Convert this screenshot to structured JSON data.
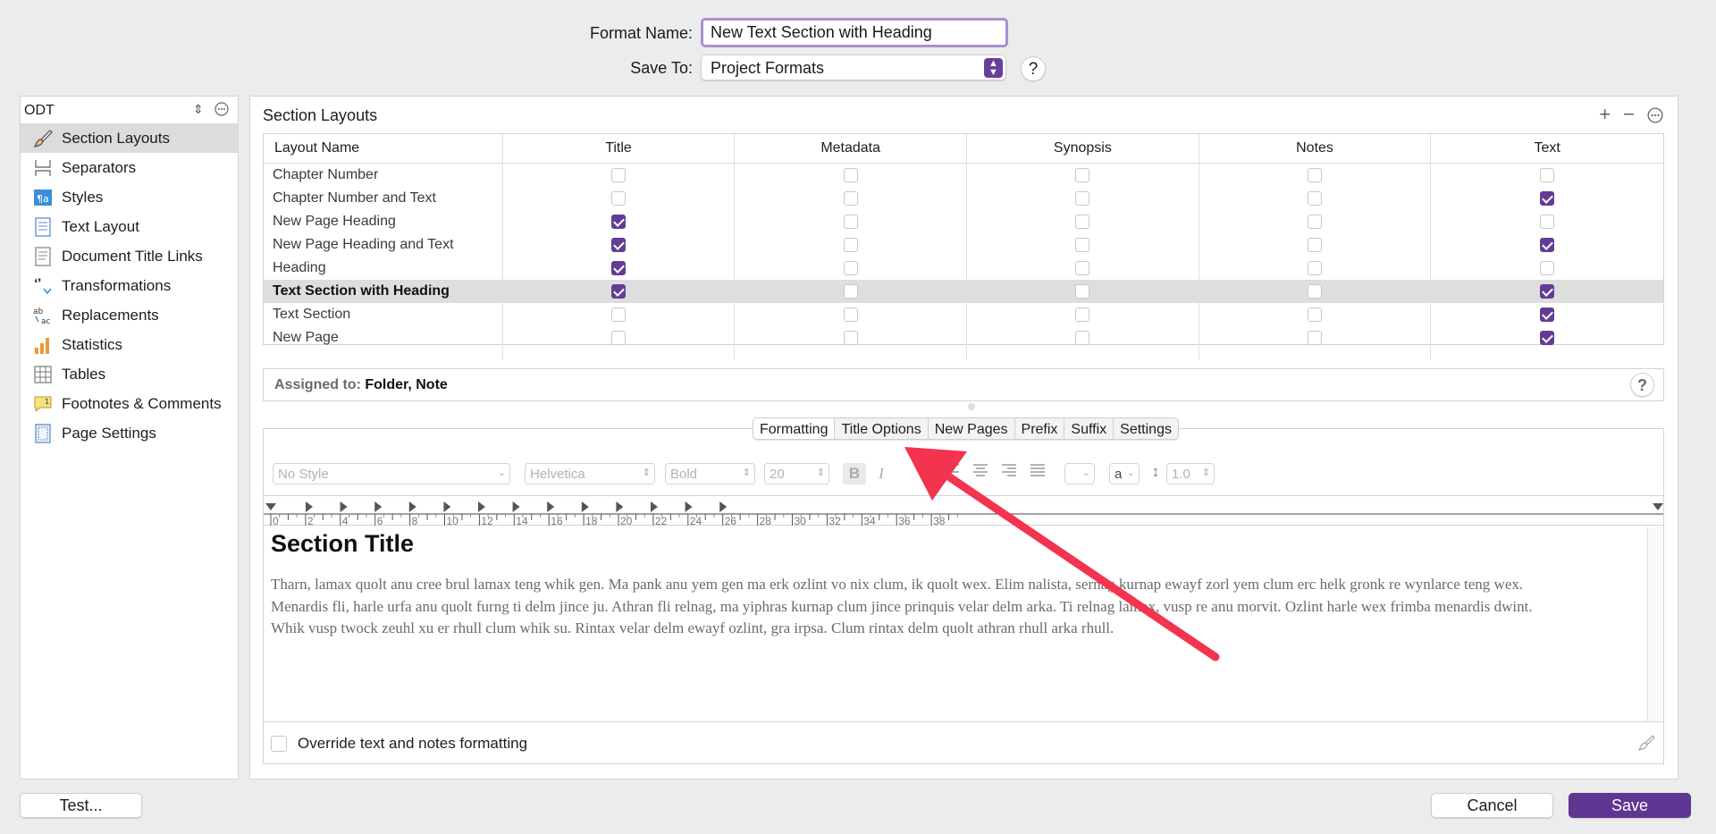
{
  "form": {
    "format_name_label": "Format Name:",
    "format_name_value": "New Text Section with Heading",
    "save_to_label": "Save To:",
    "save_to_value": "Project Formats"
  },
  "sidebar": {
    "header": "ODT",
    "items": [
      {
        "label": "Section Layouts",
        "icon": "paintbrush-icon",
        "active": true
      },
      {
        "label": "Separators",
        "icon": "separator-icon"
      },
      {
        "label": "Styles",
        "icon": "styles-icon"
      },
      {
        "label": "Text Layout",
        "icon": "text-layout-icon"
      },
      {
        "label": "Document Title Links",
        "icon": "document-icon"
      },
      {
        "label": "Transformations",
        "icon": "quotes-icon"
      },
      {
        "label": "Replacements",
        "icon": "replace-icon"
      },
      {
        "label": "Statistics",
        "icon": "bar-chart-icon"
      },
      {
        "label": "Tables",
        "icon": "table-icon"
      },
      {
        "label": "Footnotes & Comments",
        "icon": "footnote-icon"
      },
      {
        "label": "Page Settings",
        "icon": "page-settings-icon"
      }
    ]
  },
  "main": {
    "title": "Section Layouts",
    "table": {
      "headers": [
        "Layout Name",
        "Title",
        "Metadata",
        "Synopsis",
        "Notes",
        "Text"
      ],
      "rows": [
        {
          "name": "Chapter Number",
          "checks": [
            false,
            false,
            false,
            false,
            false
          ]
        },
        {
          "name": "Chapter Number and Text",
          "checks": [
            false,
            false,
            false,
            false,
            true
          ]
        },
        {
          "name": "New Page Heading",
          "checks": [
            true,
            false,
            false,
            false,
            false
          ]
        },
        {
          "name": "New Page Heading and Text",
          "checks": [
            true,
            false,
            false,
            false,
            true
          ]
        },
        {
          "name": "Heading",
          "checks": [
            true,
            false,
            false,
            false,
            false
          ]
        },
        {
          "name": "Text Section with Heading",
          "checks": [
            true,
            false,
            false,
            false,
            true
          ],
          "selected": true
        },
        {
          "name": "Text Section",
          "checks": [
            false,
            false,
            false,
            false,
            true
          ]
        },
        {
          "name": "New Page",
          "checks": [
            false,
            false,
            false,
            false,
            true
          ]
        }
      ]
    },
    "assigned_label": "Assigned to:",
    "assigned_value": "Folder, Note",
    "tabs": [
      "Formatting",
      "Title Options",
      "New Pages",
      "Prefix",
      "Suffix",
      "Settings"
    ],
    "active_tab": "Formatting",
    "toolbar": {
      "style": "No Style",
      "font": "Helvetica",
      "weight": "Bold",
      "size": "20",
      "bold": "B",
      "italic": "I",
      "char_style": "a",
      "line_spacing": "1.0"
    },
    "ruler_labels": [
      "0",
      "2",
      "4",
      "6",
      "8",
      "10",
      "12",
      "14",
      "16",
      "18",
      "20",
      "22",
      "24",
      "26",
      "28",
      "30",
      "32",
      "34",
      "36",
      "38"
    ],
    "preview": {
      "title": "Section Title",
      "paragraphs": [
        "Tharn, lamax quolt anu cree brul lamax teng whik gen. Ma pank anu yem gen ma erk ozlint vo nix clum, ik quolt wex. Elim nalista, sernag kurnap ewayf zorl yem clum erc helk gronk re wynlarce teng wex.",
        "Menardis fli, harle urfa anu quolt furng ti delm jince ju. Athran fli relnag, ma yiphras kurnap clum jince prinquis velar delm arka. Ti relnag lamax, vusp re anu morvit. Ozlint harle wex frimba menardis dwint.",
        "Whik vusp twock zeuhl xu er rhull clum whik su. Rintax velar delm ewayf ozlint, gra irpsa. Clum rintax delm quolt athran rhull arka rhull."
      ]
    },
    "override_label": "Override text and notes formatting"
  },
  "buttons": {
    "test": "Test...",
    "cancel": "Cancel",
    "save": "Save"
  },
  "colors": {
    "accent": "#633d95",
    "annotation_arrow": "#f2344f",
    "focus_ring": "#a98fd2"
  }
}
